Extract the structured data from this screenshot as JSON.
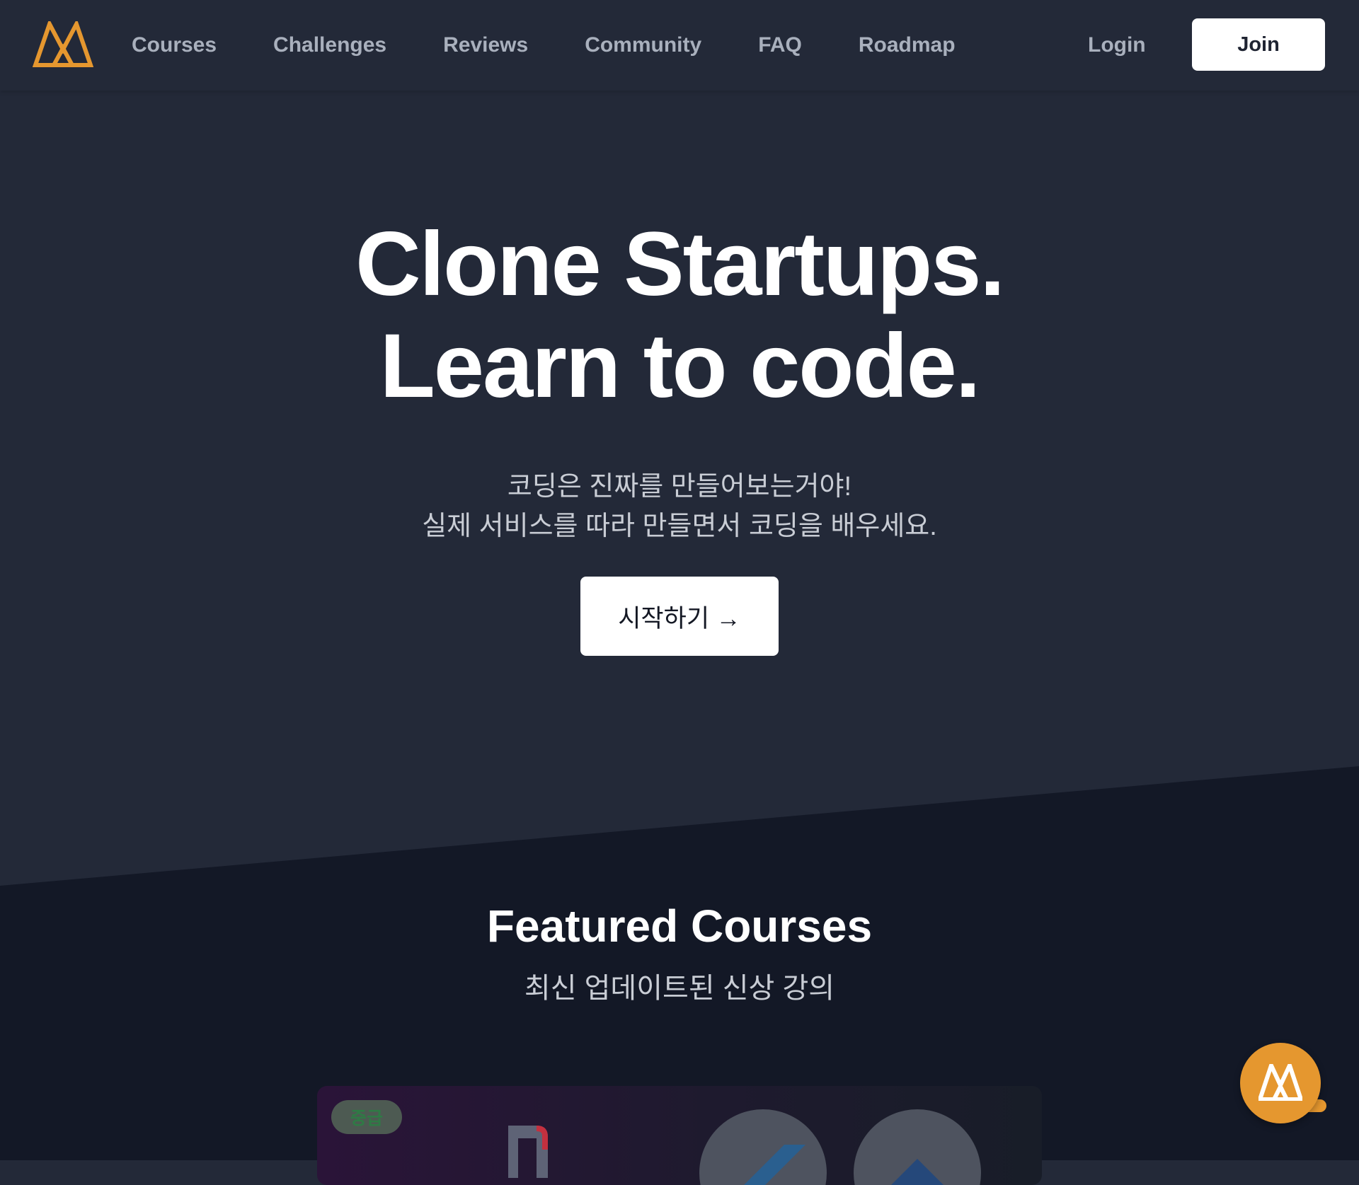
{
  "header": {
    "nav": [
      {
        "label": "Courses"
      },
      {
        "label": "Challenges"
      },
      {
        "label": "Reviews"
      },
      {
        "label": "Community"
      },
      {
        "label": "FAQ"
      },
      {
        "label": "Roadmap"
      }
    ],
    "login_label": "Login",
    "join_label": "Join"
  },
  "hero": {
    "title_line1": "Clone Startups.",
    "title_line2": "Learn to code.",
    "subtitle_line1": "코딩은 진짜를 만들어보는거야!",
    "subtitle_line2": "실제 서비스를 따라 만들면서 코딩을 배우세요.",
    "cta_label": "시작하기 →"
  },
  "featured": {
    "title": "Featured Courses",
    "subtitle": "최신 업데이트된 신상 강의",
    "card": {
      "badge": "중급"
    }
  },
  "colors": {
    "bg_header": "#232938",
    "bg_dark": "#131826",
    "accent_orange": "#e5972f",
    "text_nav": "#a9b0bd",
    "white": "#ffffff"
  },
  "icons": {
    "logo": "nomad-logo-icon",
    "chat": "chat-bubble-icon",
    "arrow": "arrow-right-icon"
  }
}
